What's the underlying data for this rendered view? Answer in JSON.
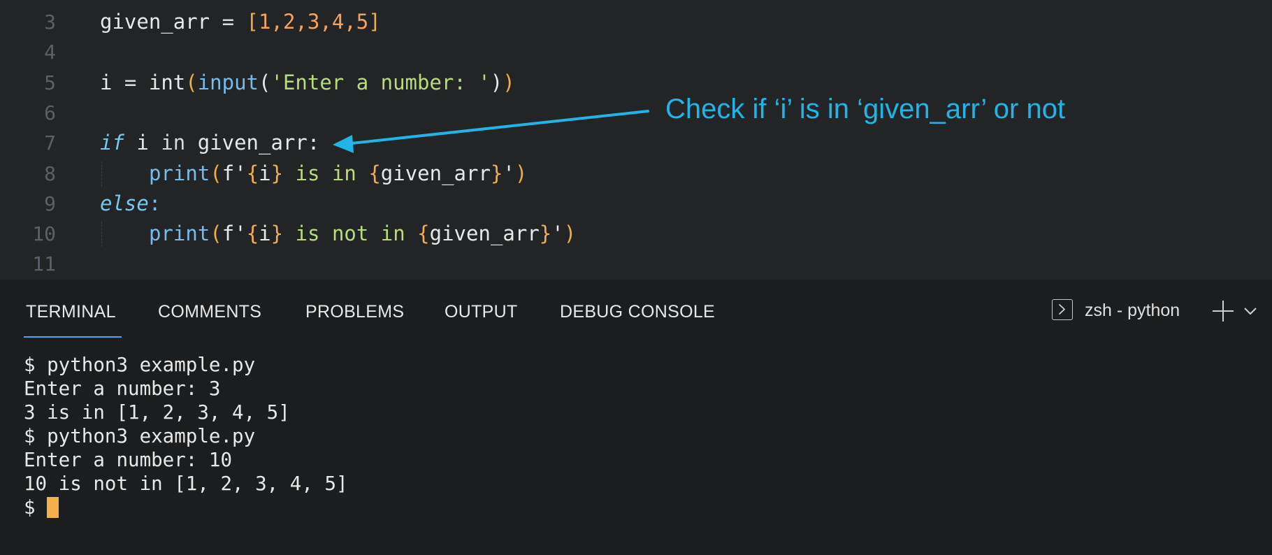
{
  "editor": {
    "lines": [
      {
        "number": "3",
        "parts": [
          "given_arr",
          " = ",
          "[",
          "1",
          ",",
          "2",
          ",",
          "3",
          ",",
          "4",
          ",",
          "5",
          "]"
        ]
      },
      {
        "number": "4"
      },
      {
        "number": "5",
        "parts": [
          "i",
          " = ",
          "int",
          "(",
          "input",
          "(",
          "'Enter a number: '",
          ")",
          ")"
        ]
      },
      {
        "number": "6"
      },
      {
        "number": "7",
        "parts": [
          "if",
          " i ",
          "in",
          " given_arr:"
        ]
      },
      {
        "number": "8",
        "parts": [
          "print",
          "(",
          "f'",
          "{",
          "i",
          "}",
          " is in ",
          "{",
          "given_arr",
          "}",
          "'",
          ")"
        ]
      },
      {
        "number": "9",
        "parts": [
          "else",
          ":"
        ]
      },
      {
        "number": "10",
        "parts": [
          "print",
          "(",
          "f'",
          "{",
          "i",
          "}",
          " is not in ",
          "{",
          "given_arr",
          "}",
          "'",
          ")"
        ]
      },
      {
        "number": "11"
      }
    ]
  },
  "annotation": {
    "text": "Check if ‘i’ is in ‘given_arr’ or not",
    "color": "#22b4e6"
  },
  "panel": {
    "tabs": [
      "TERMINAL",
      "COMMENTS",
      "PROBLEMS",
      "OUTPUT",
      "DEBUG CONSOLE"
    ],
    "active_tab": "TERMINAL",
    "shell_label": "zsh - python",
    "icons": [
      "terminal-shell-icon",
      "plus-icon",
      "chevron-down-icon"
    ]
  },
  "terminal": {
    "lines": [
      "$ python3 example.py",
      "Enter a number: 3",
      "3 is in [1, 2, 3, 4, 5]",
      "$ python3 example.py",
      "Enter a number: 10",
      "10 is not in [1, 2, 3, 4, 5]",
      "$"
    ],
    "cursor_color": "#f3b04d"
  }
}
